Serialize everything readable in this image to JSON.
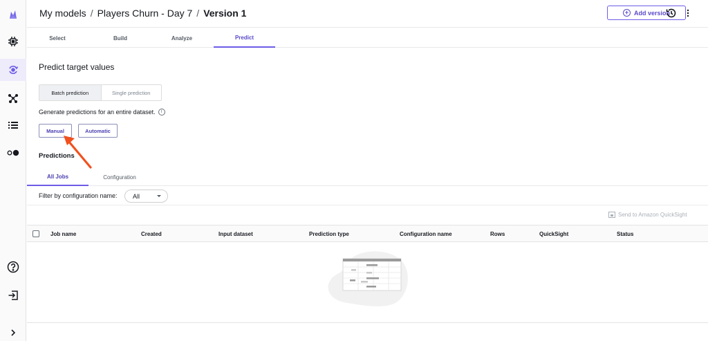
{
  "rail": {
    "items": [
      {
        "name": "canvas-logo-icon"
      },
      {
        "name": "cpu-chip-icon"
      },
      {
        "name": "model-cycle-icon"
      },
      {
        "name": "asterisk-nodes-icon"
      },
      {
        "name": "list-icon"
      },
      {
        "name": "toggle-icon"
      },
      {
        "name": "help-icon"
      },
      {
        "name": "sign-out-icon"
      },
      {
        "name": "chevron-right-icon"
      }
    ],
    "active_index": 2,
    "accent": "#6c5ce7"
  },
  "header": {
    "breadcrumb": [
      "My models",
      "Players Churn - Day 7",
      "Version 1"
    ],
    "separator": "/",
    "add_version_label": "Add version"
  },
  "tabs": [
    "Select",
    "Build",
    "Analyze",
    "Predict"
  ],
  "active_tab": "Predict",
  "predict": {
    "title": "Predict target values",
    "mode_options": [
      "Batch prediction",
      "Single prediction"
    ],
    "selected_mode": "Batch prediction",
    "description": "Generate predictions for an entire dataset.",
    "info_glyph": "i",
    "manual_label": "Manual",
    "automatic_label": "Automatic"
  },
  "predictions": {
    "title": "Predictions",
    "subtabs": [
      "All Jobs",
      "Configuration"
    ],
    "active_subtab": "All Jobs",
    "filter_label": "Filter by configuration name:",
    "filter_value": "All",
    "quicksight_label": "Send to Amazon QuickSight",
    "columns": [
      "Job name",
      "Created",
      "Input dataset",
      "Prediction type",
      "Configuration name",
      "Rows",
      "QuickSight",
      "Status"
    ],
    "rows": []
  },
  "colors": {
    "accent": "#6c5ce7",
    "accent_text": "#4a3fb0",
    "annotation_arrow": "#f0511e"
  }
}
